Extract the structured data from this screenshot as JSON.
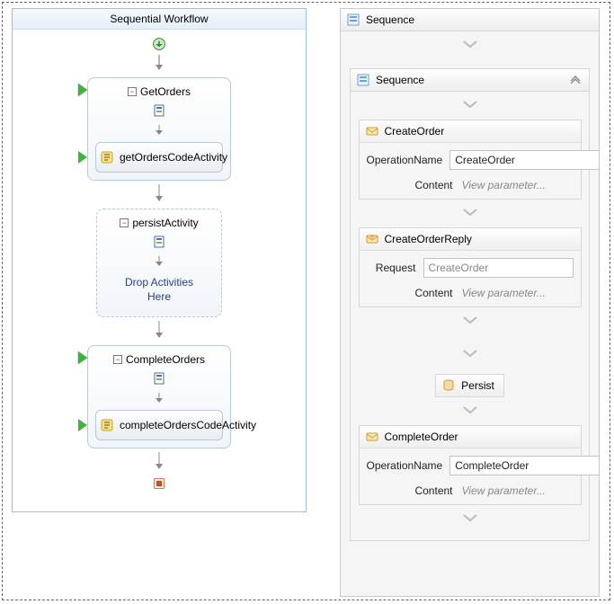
{
  "left": {
    "title": "Sequential Workflow",
    "getOrders": {
      "title": "GetOrders",
      "codeActivity": "getOrdersCodeActivity"
    },
    "persist": {
      "title": "persistActivity",
      "dropText1": "Drop Activities",
      "dropText2": "Here"
    },
    "completeOrders": {
      "title": "CompleteOrders",
      "codeActivity": "completeOrdersCodeActivity"
    }
  },
  "right": {
    "outerTitle": "Sequence",
    "innerTitle": "Sequence",
    "createOrder": {
      "title": "CreateOrder",
      "opLabel": "OperationName",
      "opValue": "CreateOrder",
      "contentLabel": "Content",
      "contentText": "View parameter..."
    },
    "createOrderReply": {
      "title": "CreateOrderReply",
      "reqLabel": "Request",
      "reqValue": "CreateOrder",
      "contentLabel": "Content",
      "contentText": "View parameter..."
    },
    "persist": {
      "title": "Persist"
    },
    "completeOrder": {
      "title": "CompleteOrder",
      "opLabel": "OperationName",
      "opValue": "CompleteOrder",
      "contentLabel": "Content",
      "contentText": "View parameter..."
    }
  }
}
